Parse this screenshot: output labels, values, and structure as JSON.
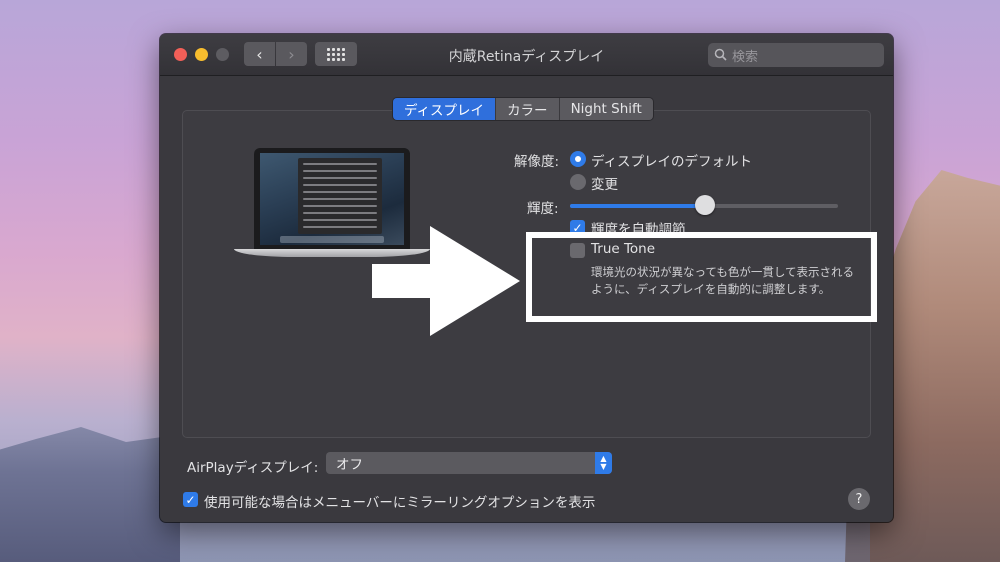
{
  "window": {
    "title": "内蔵Retinaディスプレイ",
    "search_placeholder": "検索"
  },
  "tabs": [
    {
      "label": "ディスプレイ",
      "active": true
    },
    {
      "label": "カラー",
      "active": false
    },
    {
      "label": "Night Shift",
      "active": false
    }
  ],
  "resolution": {
    "label": "解像度:",
    "options": [
      {
        "label": "ディスプレイのデフォルト",
        "selected": true
      },
      {
        "label": "変更",
        "selected": false
      }
    ]
  },
  "brightness": {
    "label": "輝度:",
    "level": 0.5,
    "auto_label": "輝度を自動調節",
    "auto_checked": true
  },
  "true_tone": {
    "label": "True Tone",
    "checked": false,
    "description_line1": "環境光の状況が異なっても色が一貫して表示される",
    "description_line2": "ように、ディスプレイを自動的に調整します。"
  },
  "airplay": {
    "label": "AirPlayディスプレイ:",
    "value": "オフ"
  },
  "mirroring": {
    "label": "使用可能な場合はメニューバーにミラーリングオプションを表示",
    "checked": true
  },
  "help": {
    "label": "?"
  },
  "colors": {
    "accent": "#2f7be8",
    "window_bg": "#3a393e",
    "annotation": "#ffffff"
  }
}
